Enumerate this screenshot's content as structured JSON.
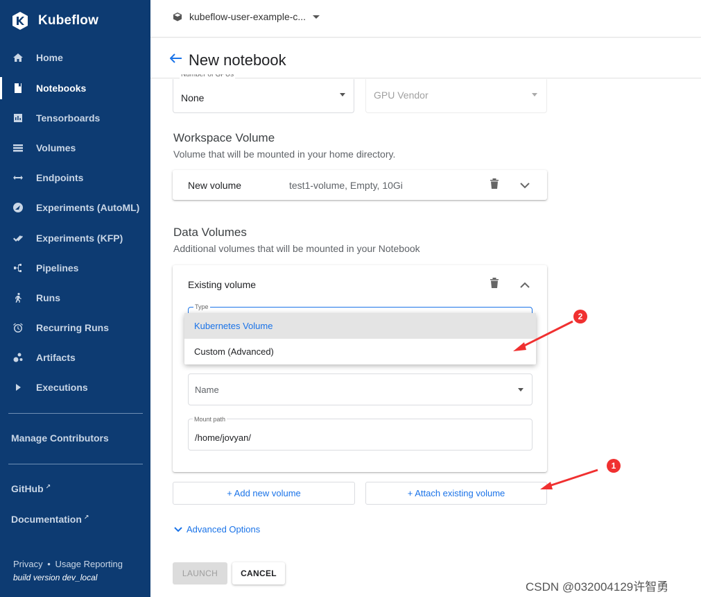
{
  "app": {
    "name": "Kubeflow"
  },
  "sidebar": {
    "items": [
      {
        "label": "Home",
        "icon": "home-icon"
      },
      {
        "label": "Notebooks",
        "icon": "notebook-icon",
        "active": true
      },
      {
        "label": "Tensorboards",
        "icon": "tensorboard-icon"
      },
      {
        "label": "Volumes",
        "icon": "volumes-icon"
      },
      {
        "label": "Endpoints",
        "icon": "endpoints-icon"
      },
      {
        "label": "Experiments (AutoML)",
        "icon": "automl-icon"
      },
      {
        "label": "Experiments (KFP)",
        "icon": "kfp-icon"
      },
      {
        "label": "Pipelines",
        "icon": "pipelines-icon"
      },
      {
        "label": "Runs",
        "icon": "runs-icon"
      },
      {
        "label": "Recurring Runs",
        "icon": "alarm-icon"
      },
      {
        "label": "Artifacts",
        "icon": "artifacts-icon"
      },
      {
        "label": "Executions",
        "icon": "play-icon"
      }
    ],
    "manage_contributors": "Manage Contributors",
    "github": "GitHub",
    "documentation": "Documentation",
    "privacy": "Privacy",
    "separator": "•",
    "usage_reporting": "Usage Reporting",
    "build_version": "build version dev_local"
  },
  "topbar": {
    "namespace": "kubeflow-user-example-c..."
  },
  "page": {
    "title": "New notebook"
  },
  "gpu": {
    "number_label": "Number of GPUs",
    "number_value": "None",
    "vendor_placeholder": "GPU Vendor"
  },
  "workspace": {
    "title": "Workspace Volume",
    "subtitle": "Volume that will be mounted in your home directory.",
    "card_label": "New volume",
    "card_detail": "test1-volume, Empty, 10Gi"
  },
  "data_volumes": {
    "title": "Data Volumes",
    "subtitle": "Additional volumes that will be mounted in your Notebook",
    "card_label": "Existing volume",
    "type_label": "Type",
    "type_options": [
      "Kubernetes Volume",
      "Custom (Advanced)"
    ],
    "name_placeholder": "Name",
    "mount_path_label": "Mount path",
    "mount_path_value": "/home/jovyan/"
  },
  "actions": {
    "add_new_volume": "+ Add new volume",
    "attach_existing_volume": "+ Attach existing volume",
    "advanced_options": "Advanced Options",
    "launch": "LAUNCH",
    "cancel": "CANCEL"
  },
  "annotations": {
    "badge1": "1",
    "badge2": "2",
    "color": "#f03030"
  },
  "watermark": "CSDN @032004129许智勇"
}
